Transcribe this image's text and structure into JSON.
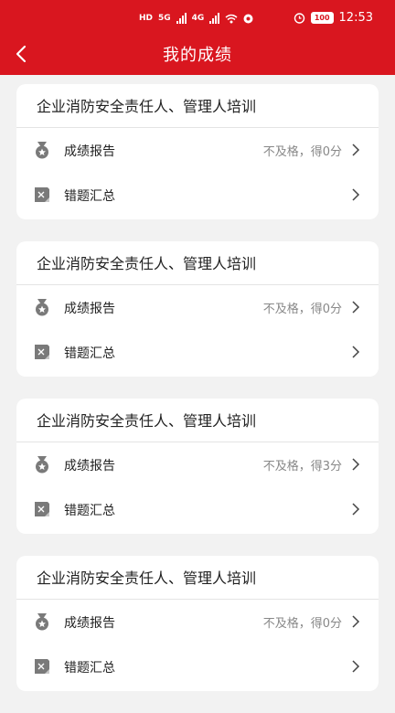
{
  "status_bar": {
    "left_indicators": [
      "HD",
      "5G",
      "4G"
    ],
    "battery": "100",
    "time": "12:53"
  },
  "header": {
    "title": "我的成绩"
  },
  "courses": [
    {
      "title": "企业消防安全责任人、管理人培训",
      "report_label": "成绩报告",
      "result": "不及格，得0分",
      "wrong_label": "错题汇总"
    },
    {
      "title": "企业消防安全责任人、管理人培训",
      "report_label": "成绩报告",
      "result": "不及格，得0分",
      "wrong_label": "错题汇总"
    },
    {
      "title": "企业消防安全责任人、管理人培训",
      "report_label": "成绩报告",
      "result": "不及格，得3分",
      "wrong_label": "错题汇总"
    },
    {
      "title": "企业消防安全责任人、管理人培训",
      "report_label": "成绩报告",
      "result": "不及格，得0分",
      "wrong_label": "错题汇总"
    }
  ],
  "icons": {
    "back": "back-arrow-icon",
    "report": "medal-icon",
    "wrong": "error-notebook-icon",
    "chevron": "chevron-right-icon"
  },
  "colors": {
    "brand": "#d9161f",
    "background": "#f2f2f2"
  }
}
